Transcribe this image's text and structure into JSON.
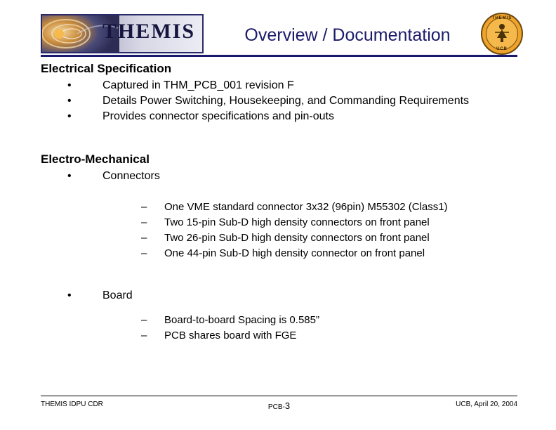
{
  "header": {
    "logo_text": "THEMIS",
    "title": "Overview / Documentation",
    "seal_top_text": "THEMIS",
    "seal_bottom_text": "UCB"
  },
  "content": {
    "section1_heading": "Electrical Specification",
    "section1_bullets": [
      "Captured in THM_PCB_001 revision F",
      "Details Power Switching, Housekeeping, and Commanding Requirements",
      "Provides connector specifications and pin-outs"
    ],
    "section2_heading": "Electro-Mechanical",
    "section2_bullet1": "Connectors",
    "section2_bullet1_sub": [
      "One VME standard connector 3x32 (96pin) M55302 (Class1)",
      "Two 15-pin Sub-D high density connectors on front panel",
      "Two 26-pin Sub-D high density connectors on front panel",
      "One 44-pin Sub-D high density connector on front panel"
    ],
    "section2_bullet2": "Board",
    "section2_bullet2_sub": [
      "Board-to-board Spacing is 0.585”",
      "PCB shares board with FGE"
    ],
    "bullet_dot": "•",
    "bullet_dash": "–"
  },
  "footer": {
    "left": "THEMIS IDPU CDR",
    "center_label": "PCB-",
    "center_page": "3",
    "right": "UCB, April 20, 2004"
  },
  "colors": {
    "title": "#1b1b6b",
    "rule": "#191970",
    "seal": "#f0a32a"
  }
}
